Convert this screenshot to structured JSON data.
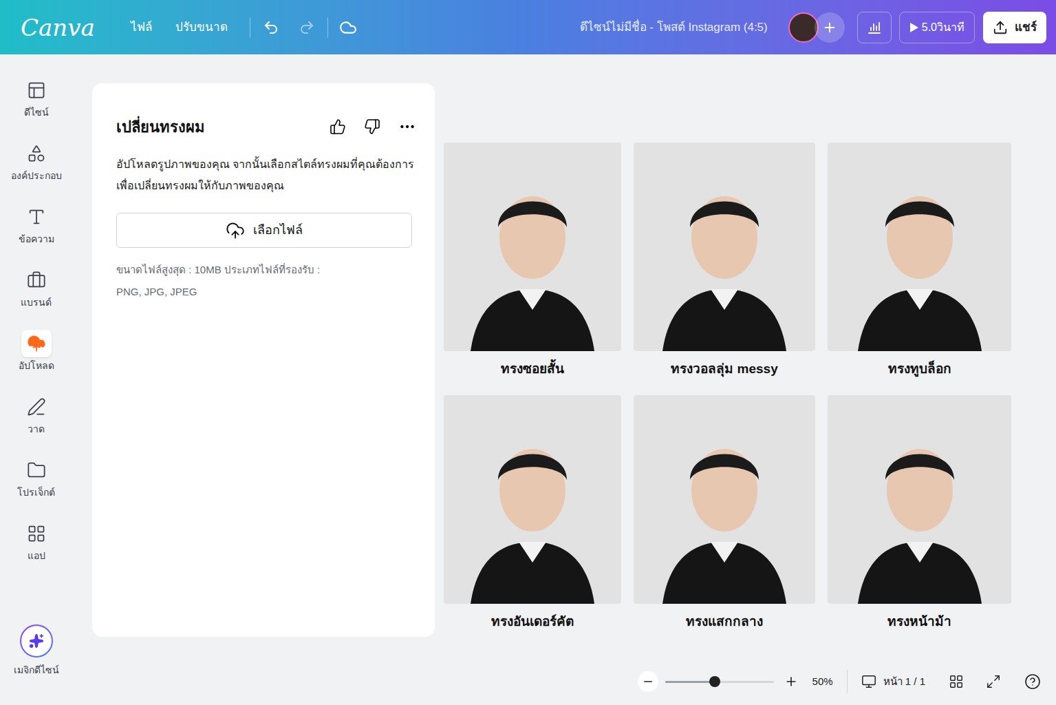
{
  "topbar": {
    "logo": "Canva",
    "menu": [
      "ไฟล์",
      "ปรับขนาด"
    ],
    "title": "ดีไซน์ไม่มีชื่อ - โพสต์ Instagram (4:5)",
    "timer": "5.0วินาที",
    "share": "แชร์"
  },
  "sidebar": {
    "items": [
      {
        "label": "ดีไซน์",
        "selected": false
      },
      {
        "label": "องค์ประกอบ",
        "selected": false
      },
      {
        "label": "ข้อความ",
        "selected": false
      },
      {
        "label": "แบรนด์",
        "selected": false
      },
      {
        "label": "อัปโหลด",
        "selected": true
      },
      {
        "label": "วาด",
        "selected": false
      },
      {
        "label": "โปรเจ็กต์",
        "selected": false
      },
      {
        "label": "แอป",
        "selected": false
      }
    ],
    "magic": "เมจิกดีไซน์"
  },
  "panel": {
    "title": "เปลี่ยนทรงผม",
    "description": [
      "อัปโหลดรูปภาพของคุณ จากนั้นเลือกสไตล์ทรงผมที่คุณต้องการ",
      "เพื่อเปลี่ยนทรงผมให้กับภาพของคุณ"
    ],
    "upload_button": "เลือกไฟล์",
    "file_info": [
      "ขนาดไฟล์สูงสุด : 10MB ประเภทไฟล์ที่รองรับ :",
      "PNG, JPG, JPEG"
    ]
  },
  "styles": [
    {
      "label": "ทรงซอยสั้น"
    },
    {
      "label": "ทรงวอลลุ่ม messy"
    },
    {
      "label": "ทรงทูบล็อก"
    },
    {
      "label": "ทรงอันเดอร์คัต"
    },
    {
      "label": "ทรงแสกกลาง"
    },
    {
      "label": "ทรงหน้าม้า"
    }
  ],
  "footer": {
    "zoom": {
      "level": 0.46,
      "reading": "50%"
    },
    "page": "หน้า 1 / 1"
  }
}
